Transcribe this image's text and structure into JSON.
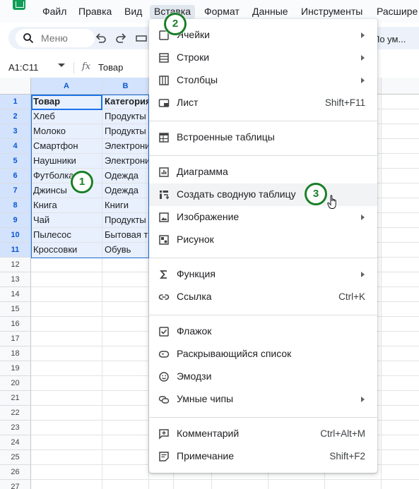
{
  "menubar": {
    "items": [
      "Файл",
      "Правка",
      "Вид",
      "Вставка",
      "Формат",
      "Данные",
      "Инструменты",
      "Расшире"
    ],
    "active_index": 3
  },
  "toolbar": {
    "search_placeholder": "Меню",
    "font_name": "По ум..."
  },
  "formula_bar": {
    "range": "A1:C11",
    "fx": "fx",
    "value": "Товар"
  },
  "grid": {
    "columns": [
      "A",
      "B"
    ],
    "row_count": 27,
    "rows": [
      [
        "Товар",
        "Категория"
      ],
      [
        "Хлеб",
        "Продукты"
      ],
      [
        "Молоко",
        "Продукты"
      ],
      [
        "Смартфон",
        "Электрони"
      ],
      [
        "Наушники",
        "Электрони"
      ],
      [
        "Футболка",
        "Одежда"
      ],
      [
        "Джинсы",
        "Одежда"
      ],
      [
        "Книга",
        "Книги"
      ],
      [
        "Чай",
        "Продукты"
      ],
      [
        "Пылесос",
        "Бытовая т"
      ],
      [
        "Кроссовки",
        "Обувь"
      ]
    ]
  },
  "menu": {
    "items": [
      {
        "label": "Ячейки",
        "icon": "cells-icon",
        "submenu": true,
        "shortcut": ""
      },
      {
        "label": "Строки",
        "icon": "rows-icon",
        "submenu": true,
        "shortcut": ""
      },
      {
        "label": "Столбцы",
        "icon": "columns-icon",
        "submenu": true,
        "shortcut": ""
      },
      {
        "label": "Лист",
        "icon": "sheet-icon",
        "submenu": false,
        "shortcut": "Shift+F11"
      },
      {
        "label": "Встроенные таблицы",
        "icon": "table-icon",
        "submenu": false,
        "shortcut": ""
      },
      {
        "label": "Диаграмма",
        "icon": "chart-icon",
        "submenu": false,
        "shortcut": ""
      },
      {
        "label": "Создать сводную таблицу",
        "icon": "pivot-table-icon",
        "submenu": false,
        "shortcut": ""
      },
      {
        "label": "Изображение",
        "icon": "image-icon",
        "submenu": true,
        "shortcut": ""
      },
      {
        "label": "Рисунок",
        "icon": "drawing-icon",
        "submenu": false,
        "shortcut": ""
      },
      {
        "label": "Функция",
        "icon": "sigma-icon",
        "submenu": true,
        "shortcut": ""
      },
      {
        "label": "Ссылка",
        "icon": "link-icon",
        "submenu": false,
        "shortcut": "Ctrl+K"
      },
      {
        "label": "Флажок",
        "icon": "checkbox-icon",
        "submenu": false,
        "shortcut": ""
      },
      {
        "label": "Раскрывающийся список",
        "icon": "dropdown-icon",
        "submenu": false,
        "shortcut": ""
      },
      {
        "label": "Эмодзи",
        "icon": "emoji-icon",
        "submenu": false,
        "shortcut": ""
      },
      {
        "label": "Умные чипы",
        "icon": "smart-chips-icon",
        "submenu": true,
        "shortcut": ""
      },
      {
        "label": "Комментарий",
        "icon": "comment-icon",
        "submenu": false,
        "shortcut": "Ctrl+Alt+M"
      },
      {
        "label": "Примечание",
        "icon": "note-icon",
        "submenu": false,
        "shortcut": "Shift+F2"
      }
    ]
  },
  "callouts": [
    "1",
    "2",
    "3"
  ],
  "colors": {
    "accent": "#1a73e8",
    "callout": "#1a7f28",
    "selection": "#e8f0fe"
  }
}
